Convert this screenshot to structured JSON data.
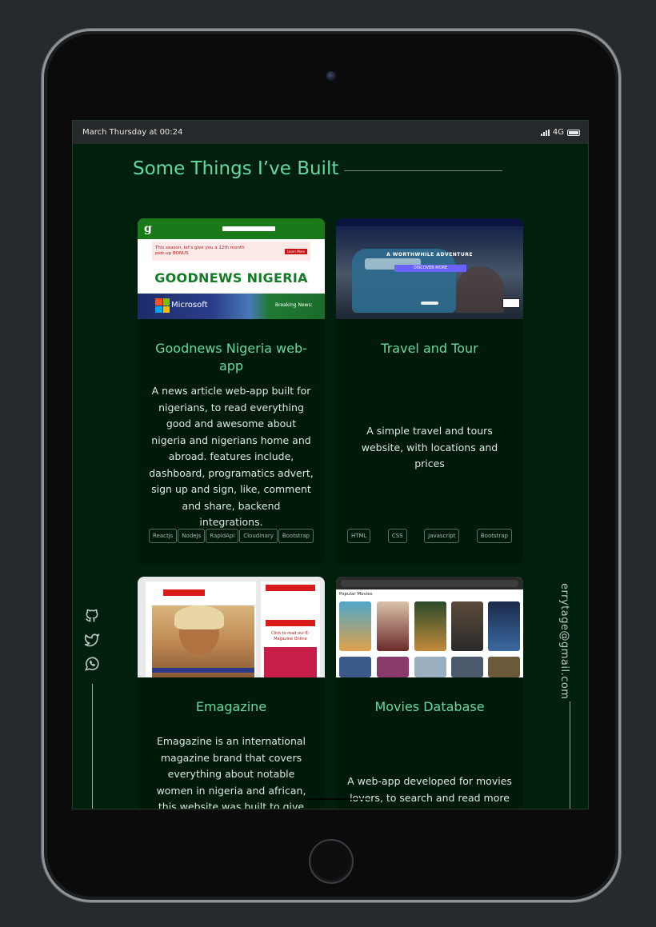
{
  "status": {
    "time": "March Thursday at 00:24",
    "network": "4G"
  },
  "section": {
    "title": "Some Things I’ve Built"
  },
  "projects": [
    {
      "title": "Goodnews Nigeria web-app",
      "description": "A news article web-app built for nigerians, to read everything good and awesome about nigeria and nigerians home and abroad. features include, dashboard, programatics advert, sign up and sign, like, comment and share, backend integrations.",
      "tags": [
        "Reactjs",
        "NodeJs",
        "RapidApi",
        "Cloudinary",
        "Bootstrap"
      ],
      "thumb": {
        "banner": "GOODNEWS NIGERIA",
        "ad": "This season, let's give you a 12th month pick-up BONUS",
        "ad_cta": "Learn More",
        "brand": "Microsoft",
        "breaking": "Breaking News:"
      }
    },
    {
      "title": "Travel and Tour",
      "description": "A simple travel and tours website, with locations and prices",
      "tags": [
        "HTML",
        "CSS",
        "Javascript",
        "Bootstrap"
      ],
      "thumb": {
        "headline": "A WORTHWHILE ADVENTURE",
        "cta": "DISCOVER MORE"
      }
    },
    {
      "title": "Emagazine",
      "description": "Emagazine is an international magazine brand that covers everything about notable women in nigeria and african, this website was built to give the brand an",
      "tags": [],
      "thumb": {
        "side_link": "Click to read our E-Magazine Online"
      }
    },
    {
      "title": "Movies Database",
      "description": "A web-app developed for movies lovers, to search and read more",
      "tags": [],
      "thumb": {
        "label": "Popular Movies"
      }
    }
  ],
  "contact": {
    "email": "errytage@gmail.com"
  },
  "colors": {
    "accent": "#64d8a0",
    "background": "#00200d",
    "card": "#001a0a"
  }
}
